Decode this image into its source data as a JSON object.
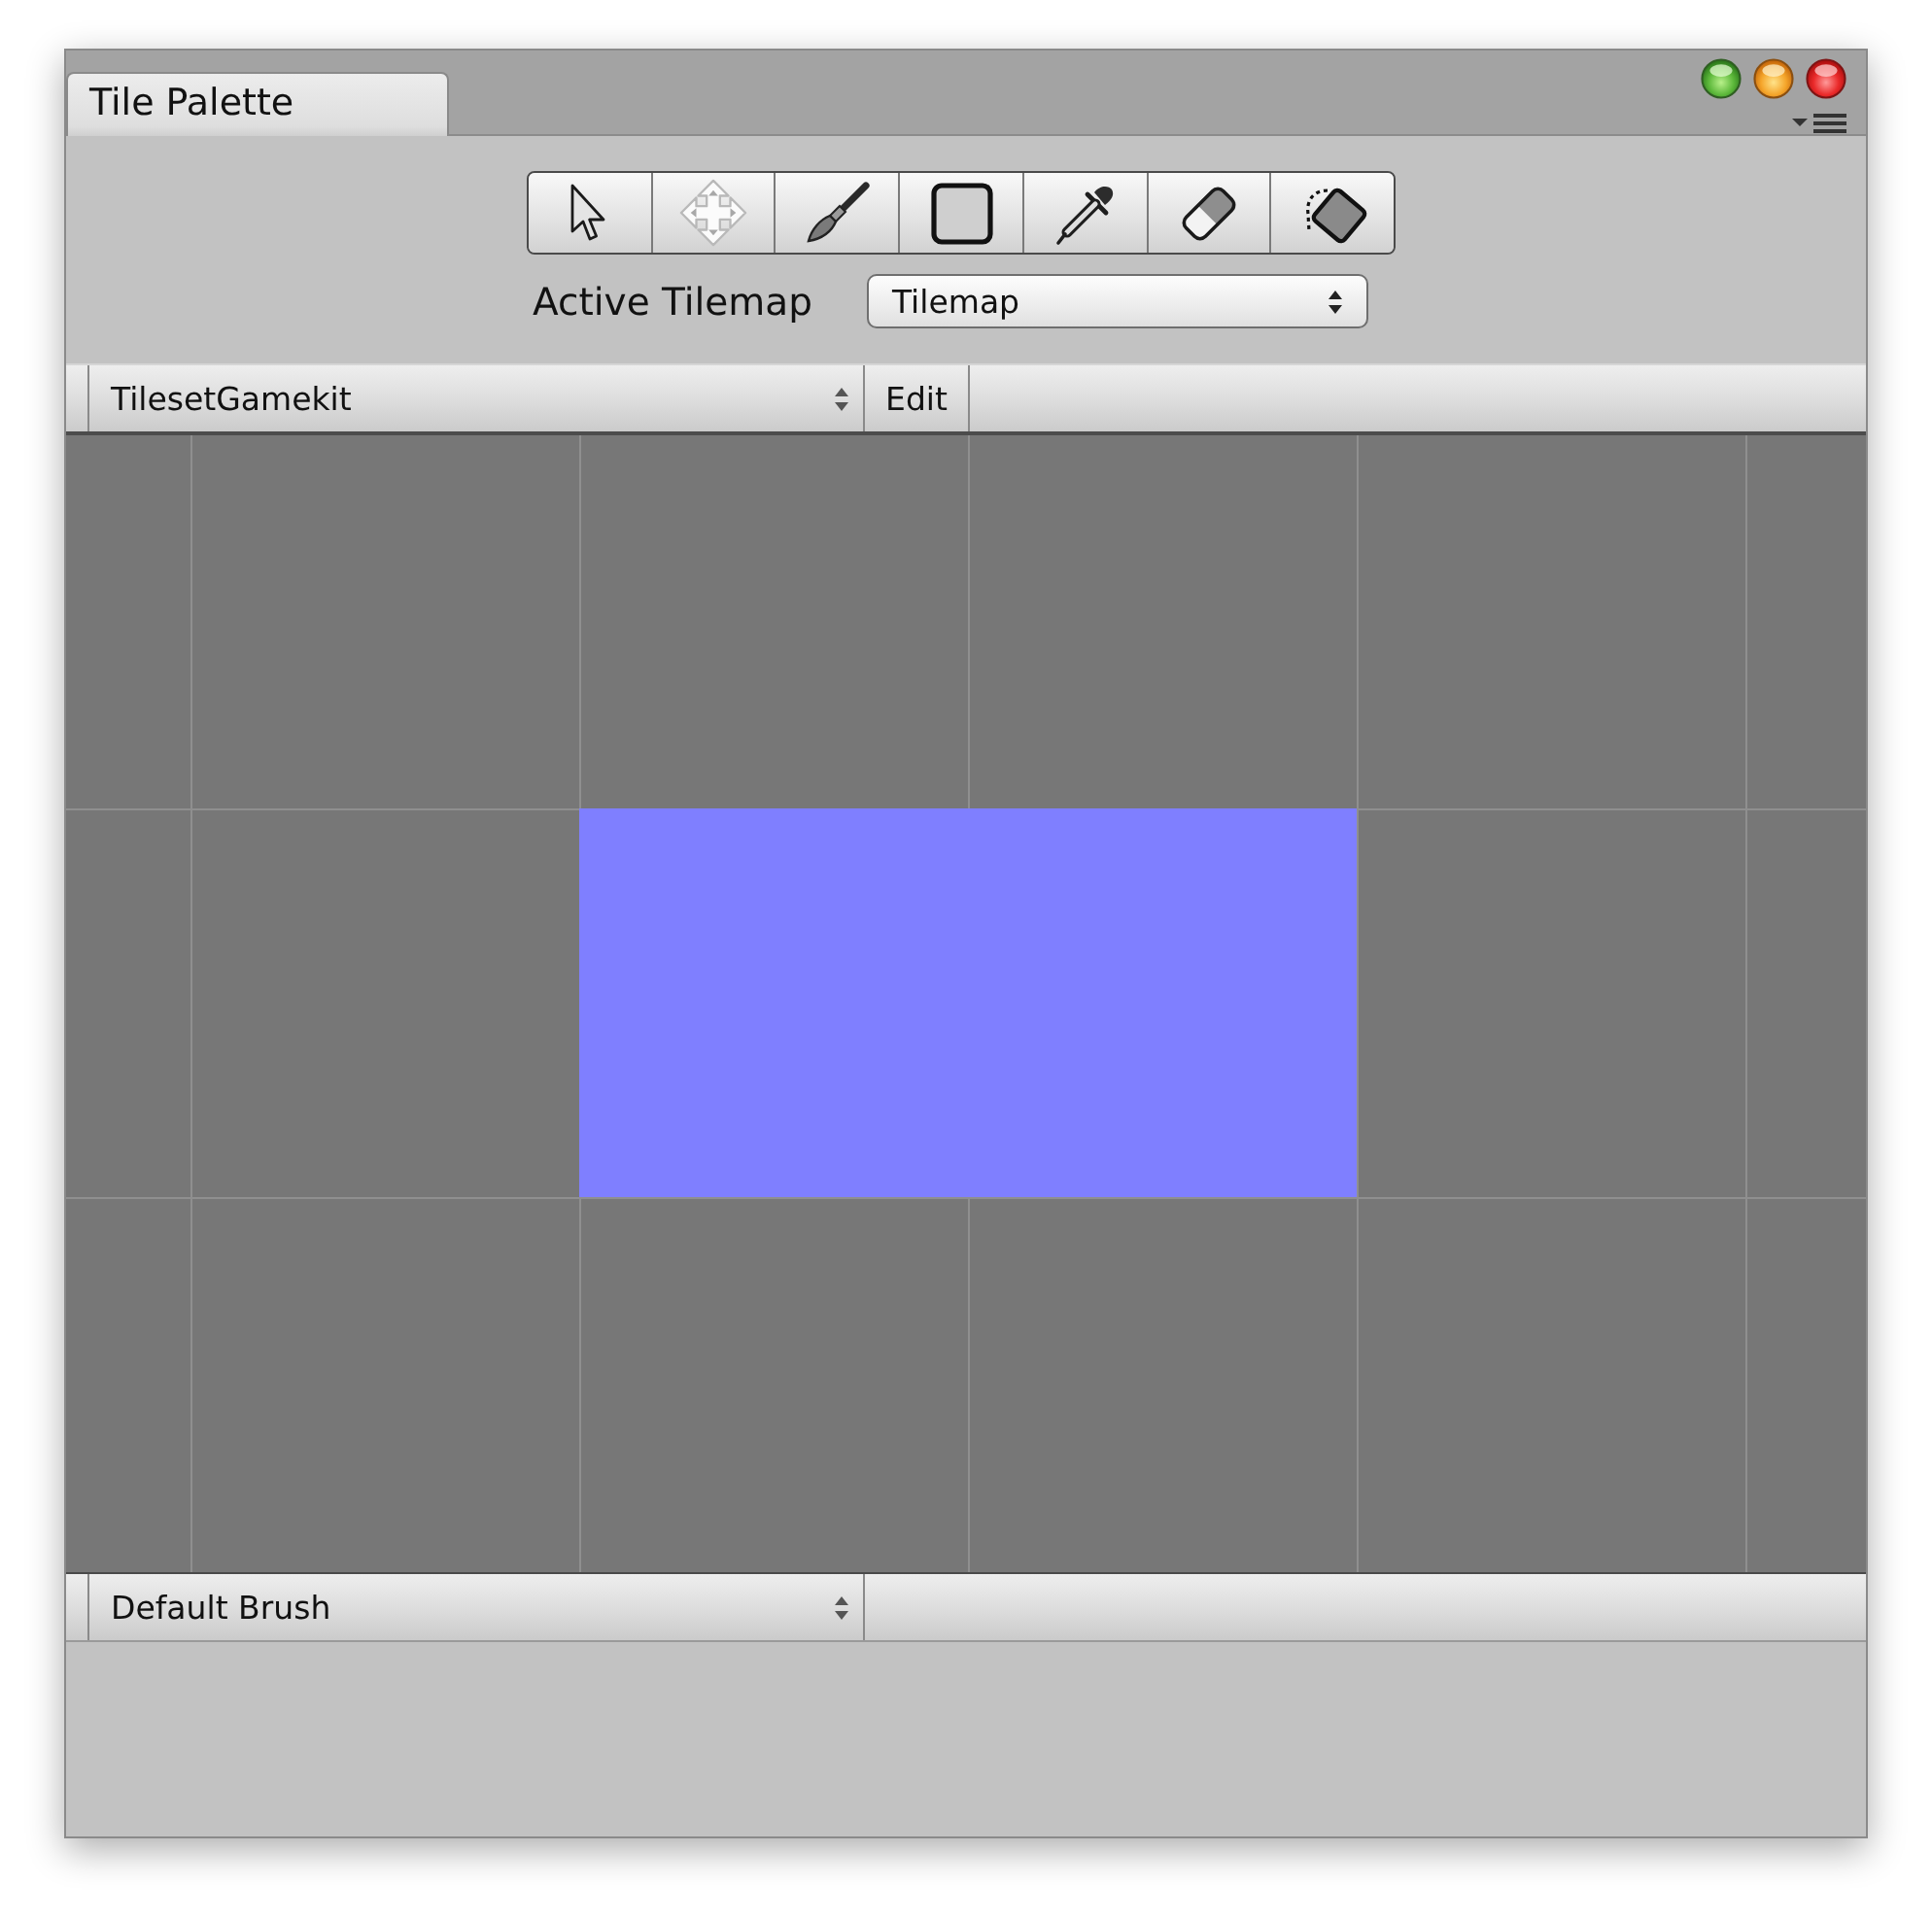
{
  "window": {
    "tabs": [
      {
        "label": "Tile Palette",
        "selected": true
      }
    ]
  },
  "tools": [
    {
      "kind": "select",
      "selected": false
    },
    {
      "kind": "move",
      "selected": false
    },
    {
      "kind": "paint",
      "selected": false
    },
    {
      "kind": "box",
      "selected": false
    },
    {
      "kind": "pick",
      "selected": false
    },
    {
      "kind": "erase",
      "selected": false
    },
    {
      "kind": "fill",
      "selected": false
    }
  ],
  "active_tilemap": {
    "label": "Active Tilemap",
    "value": "Tilemap"
  },
  "palette_bar": {
    "palette": "TilesetGamekit",
    "edit_button": "Edit"
  },
  "brush_bar": {
    "brush": "Default Brush"
  }
}
